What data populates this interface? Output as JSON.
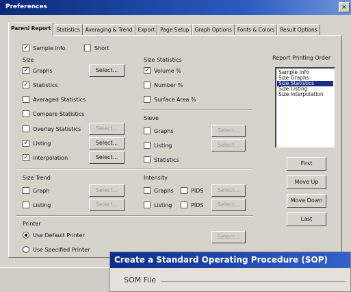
{
  "window": {
    "title": "Preferences",
    "close_label": "×"
  },
  "tabs": [
    {
      "label": "Pareni Report",
      "active": true
    },
    {
      "label": "Statistics"
    },
    {
      "label": "Averaging & Trend"
    },
    {
      "label": "Export"
    },
    {
      "label": "Page Setup"
    },
    {
      "label": "Graph Options"
    },
    {
      "label": "Fonts & Colors"
    },
    {
      "label": "Result Options"
    }
  ],
  "top_checks": {
    "sample_info": "Sample Info",
    "short": "Short"
  },
  "size": {
    "heading": "Size",
    "graphs": "Graphs",
    "statistics": "Statistics",
    "averaged": "Averaged Statistics",
    "compare": "Compare Statistics",
    "overlay": "Overlay Statistics",
    "listing": "Listing",
    "interpolation": "Interpolation"
  },
  "size_stats": {
    "heading": "Size Statistics",
    "volume": "Volume %",
    "number": "Number %",
    "surface": "Surface Area %"
  },
  "sieve": {
    "heading": "Sieve",
    "graphs": "Graphs",
    "listing": "Listing",
    "statistics": "Statistics"
  },
  "size_trend": {
    "heading": "Size Trend",
    "graph": "Graph",
    "listing": "Listing"
  },
  "intensity": {
    "heading": "Intensity",
    "graphs": "Graphs",
    "listing": "Listing",
    "pids": "PIDS"
  },
  "printer": {
    "heading": "Printer",
    "default": "Use Default Printer",
    "specified": "Use Specified Printer"
  },
  "buttons": {
    "select": "Select..."
  },
  "report_order": {
    "heading": "Report Printing Order",
    "items": [
      "Sample Info",
      "Size Graphs",
      "Size Statistics",
      "Size Listing",
      "Size Interpolation"
    ],
    "selected": 2,
    "first": "First",
    "move_up": "Move Up",
    "move_down": "Move Down",
    "last": "Last"
  },
  "overlay": {
    "title": "Create a Standard Operating Procedure (SOP)",
    "subtitle": "SOM File"
  }
}
